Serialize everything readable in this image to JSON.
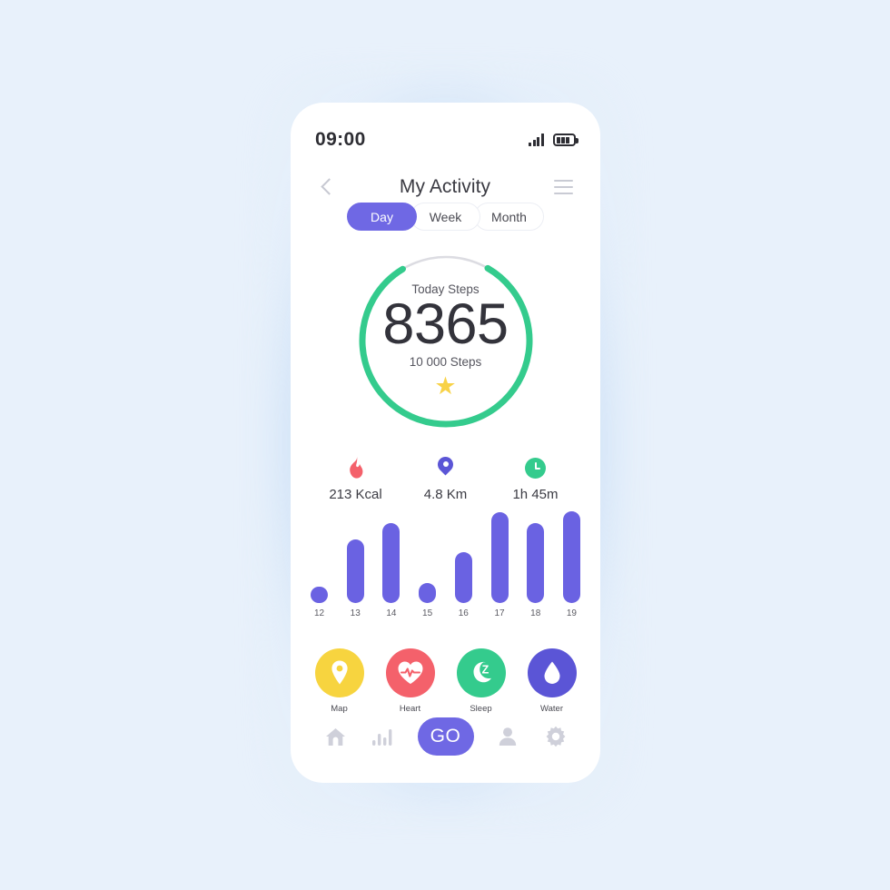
{
  "theme": {
    "page_background": "#e8f1fb",
    "phone_background": "#ffffff",
    "accent_purple": "#6f68e4",
    "accent_green": "#34cb8d",
    "accent_red": "#f4616b",
    "accent_yellow": "#f8d247",
    "ring_track": "#dcdce2",
    "text_dark": "#33333b",
    "text_muted": "#5b5b63"
  },
  "status_bar": {
    "time": "09:00",
    "signal_icon": "signal-bars-icon",
    "battery_icon": "battery-icon"
  },
  "nav": {
    "back_icon": "chevron-left-icon",
    "title": "My Activity",
    "menu_icon": "hamburger-menu-icon"
  },
  "tabs": {
    "items": [
      {
        "label": "Day",
        "active": true
      },
      {
        "label": "Week",
        "active": false
      },
      {
        "label": "Month",
        "active": false
      }
    ]
  },
  "ring": {
    "label": "Today Steps",
    "value": "8365",
    "goal": "10 000 Steps",
    "badge_icon": "star-icon",
    "progress_percent": 83,
    "track_color": "#dcdce2",
    "progress_color": "#34cb8d"
  },
  "stats": [
    {
      "icon": "flame-icon",
      "value": "213 Kcal",
      "color": "#f4616b"
    },
    {
      "icon": "location-pin-icon",
      "value": "4.8 Km",
      "color": "#5b55d6"
    },
    {
      "icon": "clock-icon",
      "value": "1h 45m",
      "color": "#34cb8d"
    }
  ],
  "chart_data": {
    "type": "bar",
    "title": "",
    "xlabel": "",
    "ylabel": "",
    "categories": [
      "12",
      "13",
      "14",
      "15",
      "16",
      "17",
      "18",
      "19"
    ],
    "values": [
      18,
      70,
      88,
      22,
      56,
      100,
      88,
      112
    ],
    "ylim": [
      0,
      118
    ],
    "grid": false,
    "legend": "none",
    "bar_color": "#6a62e2"
  },
  "shortcuts": [
    {
      "label": "Map",
      "icon": "map-pin-icon",
      "color": "#f7d43f"
    },
    {
      "label": "Heart",
      "icon": "heartbeat-icon",
      "color": "#f4616b"
    },
    {
      "label": "Sleep",
      "icon": "moon-sleep-icon",
      "color": "#34cb8d"
    },
    {
      "label": "Water",
      "icon": "water-drop-icon",
      "color": "#5b55d6"
    }
  ],
  "bottom_nav": {
    "items": [
      {
        "icon": "home-icon",
        "label": ""
      },
      {
        "icon": "bar-chart-icon",
        "label": ""
      }
    ],
    "go_label": "GO",
    "items_right": [
      {
        "icon": "person-icon",
        "label": ""
      },
      {
        "icon": "gear-icon",
        "label": ""
      }
    ]
  }
}
